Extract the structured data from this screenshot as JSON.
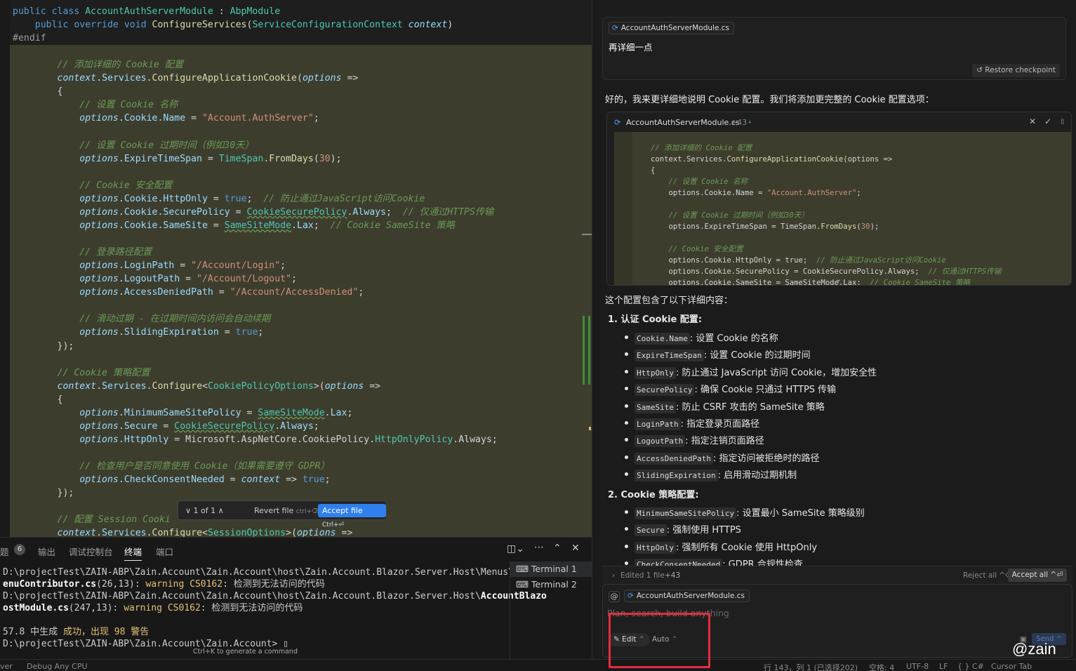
{
  "editor": {
    "lines": [
      [
        [
          "kw",
          "public "
        ],
        [
          "kw",
          "class "
        ],
        [
          "ty",
          "AccountAuthServerModule"
        ],
        [
          "op",
          " : "
        ],
        [
          "ty",
          "AbpModule"
        ]
      ],
      [
        [
          "op",
          "    "
        ],
        [
          "kw",
          "public "
        ],
        [
          "kw",
          "override "
        ],
        [
          "kw",
          "void "
        ],
        [
          "fn",
          "ConfigureServices"
        ],
        [
          "op",
          "("
        ],
        [
          "ty",
          "ServiceConfigurationContext"
        ],
        [
          "op",
          " "
        ],
        [
          "pr it",
          "context"
        ],
        [
          "op",
          ")"
        ]
      ],
      [
        [
          "pp",
          "#endif"
        ]
      ],
      [
        [
          "op",
          ""
        ]
      ],
      [
        [
          "cm",
          "        // 添加详细的 Cookie 配置"
        ]
      ],
      [
        [
          "op",
          "        "
        ],
        [
          "pr it",
          "context"
        ],
        [
          "op",
          "."
        ],
        [
          "pr",
          "Services"
        ],
        [
          "op",
          "."
        ],
        [
          "fn",
          "ConfigureApplicationCookie"
        ],
        [
          "op",
          "("
        ],
        [
          "pr it",
          "options"
        ],
        [
          "op",
          " =>"
        ]
      ],
      [
        [
          "op",
          "        {"
        ]
      ],
      [
        [
          "cm",
          "            // 设置 Cookie 名称"
        ]
      ],
      [
        [
          "op",
          "            "
        ],
        [
          "pr it",
          "options"
        ],
        [
          "op",
          "."
        ],
        [
          "pr",
          "Cookie"
        ],
        [
          "op",
          "."
        ],
        [
          "pr",
          "Name"
        ],
        [
          "op",
          " = "
        ],
        [
          "st",
          "\"Account.AuthServer\""
        ],
        [
          "op",
          ";"
        ]
      ],
      [
        [
          "op",
          ""
        ]
      ],
      [
        [
          "cm",
          "            // 设置 Cookie 过期时间（例如30天）"
        ]
      ],
      [
        [
          "op",
          "            "
        ],
        [
          "pr it",
          "options"
        ],
        [
          "op",
          "."
        ],
        [
          "pr",
          "ExpireTimeSpan"
        ],
        [
          "op",
          " = "
        ],
        [
          "ty",
          "TimeSpan"
        ],
        [
          "op",
          "."
        ],
        [
          "fn",
          "FromDays"
        ],
        [
          "op",
          "("
        ],
        [
          "st",
          "30"
        ],
        [
          "op",
          ");"
        ]
      ],
      [
        [
          "op",
          ""
        ]
      ],
      [
        [
          "cm",
          "            // Cookie 安全配置"
        ]
      ],
      [
        [
          "op",
          "            "
        ],
        [
          "pr it",
          "options"
        ],
        [
          "op",
          "."
        ],
        [
          "pr",
          "Cookie"
        ],
        [
          "op",
          "."
        ],
        [
          "pr",
          "HttpOnly"
        ],
        [
          "op",
          " = "
        ],
        [
          "kw",
          "true"
        ],
        [
          "op",
          ";  "
        ],
        [
          "cm",
          "// 防止通过JavaScript访问Cookie"
        ]
      ],
      [
        [
          "op",
          "            "
        ],
        [
          "pr it",
          "options"
        ],
        [
          "op",
          "."
        ],
        [
          "pr",
          "Cookie"
        ],
        [
          "op",
          "."
        ],
        [
          "pr",
          "SecurePolicy"
        ],
        [
          "op",
          " = "
        ],
        [
          "ty sq",
          "CookieSecurePolicy"
        ],
        [
          "op",
          "."
        ],
        [
          "pr",
          "Always"
        ],
        [
          "op",
          ";  "
        ],
        [
          "cm",
          "// 仅通过HTTPS传输"
        ]
      ],
      [
        [
          "op",
          "            "
        ],
        [
          "pr it",
          "options"
        ],
        [
          "op",
          "."
        ],
        [
          "pr",
          "Cookie"
        ],
        [
          "op",
          "."
        ],
        [
          "pr",
          "SameSite"
        ],
        [
          "op",
          " = "
        ],
        [
          "ty sq",
          "SameSiteMode"
        ],
        [
          "op",
          "."
        ],
        [
          "pr",
          "Lax"
        ],
        [
          "op",
          ";  "
        ],
        [
          "cm",
          "// Cookie SameSite 策略"
        ]
      ],
      [
        [
          "op",
          ""
        ]
      ],
      [
        [
          "cm",
          "            // 登录路径配置"
        ]
      ],
      [
        [
          "op",
          "            "
        ],
        [
          "pr it",
          "options"
        ],
        [
          "op",
          "."
        ],
        [
          "pr",
          "LoginPath"
        ],
        [
          "op",
          " = "
        ],
        [
          "st",
          "\"/Account/Login\""
        ],
        [
          "op",
          ";"
        ]
      ],
      [
        [
          "op",
          "            "
        ],
        [
          "pr it",
          "options"
        ],
        [
          "op",
          "."
        ],
        [
          "pr",
          "LogoutPath"
        ],
        [
          "op",
          " = "
        ],
        [
          "st",
          "\"/Account/Logout\""
        ],
        [
          "op",
          ";"
        ]
      ],
      [
        [
          "op",
          "            "
        ],
        [
          "pr it",
          "options"
        ],
        [
          "op",
          "."
        ],
        [
          "pr",
          "AccessDeniedPath"
        ],
        [
          "op",
          " = "
        ],
        [
          "st",
          "\"/Account/AccessDenied\""
        ],
        [
          "op",
          ";"
        ]
      ],
      [
        [
          "op",
          ""
        ]
      ],
      [
        [
          "cm",
          "            // 滑动过期 - 在过期时间内访问会自动续期"
        ]
      ],
      [
        [
          "op",
          "            "
        ],
        [
          "pr it",
          "options"
        ],
        [
          "op",
          "."
        ],
        [
          "pr",
          "SlidingExpiration"
        ],
        [
          "op",
          " = "
        ],
        [
          "kw",
          "true"
        ],
        [
          "op",
          ";"
        ]
      ],
      [
        [
          "op",
          "        });"
        ]
      ],
      [
        [
          "op",
          ""
        ]
      ],
      [
        [
          "cm",
          "        // Cookie 策略配置"
        ]
      ],
      [
        [
          "op",
          "        "
        ],
        [
          "pr it",
          "context"
        ],
        [
          "op",
          "."
        ],
        [
          "pr",
          "Services"
        ],
        [
          "op",
          "."
        ],
        [
          "fn",
          "Configure"
        ],
        [
          "op",
          "<"
        ],
        [
          "ty",
          "CookiePolicyOptions"
        ],
        [
          "op",
          ">("
        ],
        [
          "pr it",
          "options"
        ],
        [
          "op",
          " =>"
        ]
      ],
      [
        [
          "op",
          "        {"
        ]
      ],
      [
        [
          "op",
          "            "
        ],
        [
          "pr it",
          "options"
        ],
        [
          "op",
          "."
        ],
        [
          "pr",
          "MinimumSameSitePolicy"
        ],
        [
          "op",
          " = "
        ],
        [
          "ty sq",
          "SameSiteMode"
        ],
        [
          "op",
          "."
        ],
        [
          "pr",
          "Lax"
        ],
        [
          "op",
          ";"
        ]
      ],
      [
        [
          "op",
          "            "
        ],
        [
          "pr it",
          "options"
        ],
        [
          "op",
          "."
        ],
        [
          "pr",
          "Secure"
        ],
        [
          "op",
          " = "
        ],
        [
          "ty sq",
          "CookieSecurePolicy"
        ],
        [
          "op",
          "."
        ],
        [
          "pr",
          "Always"
        ],
        [
          "op",
          ";"
        ]
      ],
      [
        [
          "op",
          "            "
        ],
        [
          "pr it",
          "options"
        ],
        [
          "op",
          "."
        ],
        [
          "pr",
          "HttpOnly"
        ],
        [
          "op",
          " = Microsoft.AspNetCore.CookiePolicy."
        ],
        [
          "ty",
          "HttpOnlyPolicy"
        ],
        [
          "op",
          ".Always;"
        ]
      ],
      [
        [
          "op",
          ""
        ]
      ],
      [
        [
          "cm",
          "            // 检查用户是否同意使用 Cookie（如果需要遵守 GDPR）"
        ]
      ],
      [
        [
          "op",
          "            "
        ],
        [
          "pr it",
          "options"
        ],
        [
          "op",
          "."
        ],
        [
          "pr",
          "CheckConsentNeeded"
        ],
        [
          "op",
          " = "
        ],
        [
          "pr it",
          "context"
        ],
        [
          "op",
          " => "
        ],
        [
          "kw",
          "true"
        ],
        [
          "op",
          ";"
        ]
      ],
      [
        [
          "op",
          "        });"
        ]
      ],
      [
        [
          "op",
          ""
        ]
      ],
      [
        [
          "cm",
          "        // 配置 Session Cooki"
        ]
      ],
      [
        [
          "op",
          "        "
        ],
        [
          "pr it",
          "context"
        ],
        [
          "op",
          "."
        ],
        [
          "pr",
          "Services"
        ],
        [
          "op",
          "."
        ],
        [
          "fn",
          "Configure"
        ],
        [
          "op",
          "<"
        ],
        [
          "ty",
          "SessionOptions"
        ],
        [
          "op",
          ">("
        ],
        [
          "pr it",
          "options"
        ],
        [
          "op",
          " =>"
        ]
      ]
    ]
  },
  "diff_toolbar": {
    "pager": "∨ 1 of 1 ∧",
    "revert": "Revert file",
    "revert_shortcut": "ctrl+⌫",
    "accept": "Accept file",
    "accept_shortcut": "Ctrl+⏎"
  },
  "panel": {
    "tabs": [
      "题",
      "6",
      "输出",
      "调试控制台",
      "终端",
      "端口"
    ],
    "terminal_lines": [
      [
        [
          "",
          "D:\\projectTest\\ZAIN-ABP\\Zain.Account\\Zain.Account\\host\\Zain.Account.Blazor.Server.Host\\Menus\\"
        ],
        [
          "b",
          "Accoun"
        ]
      ],
      [
        [
          "b",
          "enuContributor.cs"
        ],
        [
          "",
          "(26,13): "
        ],
        [
          "w",
          "warning CS0162"
        ],
        [
          "",
          ": 检测到无法访问的代码"
        ]
      ],
      [
        [
          "",
          "D:\\projectTest\\ZAIN-ABP\\Zain.Account\\Zain.Account\\host\\Zain.Account.Blazor.Server.Host\\"
        ],
        [
          "b",
          "AccountBlazo"
        ]
      ],
      [
        [
          "b",
          "ostModule.cs"
        ],
        [
          "",
          "(247,13): "
        ],
        [
          "w",
          "warning CS0162"
        ],
        [
          "",
          ": 检测到无法访问的代码"
        ]
      ],
      [
        [
          "",
          ""
        ]
      ],
      [
        [
          "",
          "57.8 中生成 "
        ],
        [
          "ok",
          "成功，出现 98 警告"
        ]
      ],
      [
        [
          "",
          "D:\\projectTest\\ZAIN-ABP\\Zain.Account\\Zain.Account> ▯"
        ]
      ]
    ],
    "terminals": [
      "Terminal 1",
      "Terminal 2"
    ],
    "hint": "Ctrl+K to generate a command"
  },
  "status": {
    "left1": "ver",
    "left2": "Debug Any CPU",
    "position": "行 143，列 1 (已选择202)",
    "spaces": "空格: 4",
    "encoding": "UTF-8",
    "eol": "LF",
    "lang": "{ } C#",
    "tab": "Cursor Tab"
  },
  "chat": {
    "file_chip": "AccountAuthServerModule.cs",
    "user_message": "再详细一点",
    "restore": "Restore checkpoint",
    "intro": "好的，我来更详细地说明 Cookie 配置。我们将添加更完整的 Cookie 配置选项：",
    "code_header": "AccountAuthServerModule.cs",
    "code_added": "+43",
    "snippet": [
      [
        [
          "cm",
          "// 添加详细的 Cookie 配置"
        ]
      ],
      [
        [
          "op",
          "context.Services."
        ],
        [
          "fn",
          "ConfigureApplicationCookie"
        ],
        [
          "op",
          "(options =>"
        ]
      ],
      [
        [
          "op",
          "{"
        ]
      ],
      [
        [
          "cm",
          "    // 设置 Cookie 名称"
        ]
      ],
      [
        [
          "op",
          "    options.Cookie.Name = "
        ],
        [
          "st",
          "\"Account.AuthServer\""
        ],
        [
          "op",
          ";"
        ]
      ],
      [
        [
          "op",
          ""
        ]
      ],
      [
        [
          "cm",
          "    // 设置 Cookie 过期时间（例如30天）"
        ]
      ],
      [
        [
          "op",
          "    options.ExpireTimeSpan = TimeSpan."
        ],
        [
          "fn",
          "FromDays"
        ],
        [
          "op",
          "("
        ],
        [
          "st",
          "30"
        ],
        [
          "op",
          ");"
        ]
      ],
      [
        [
          "op",
          ""
        ]
      ],
      [
        [
          "cm",
          "    // Cookie 安全配置"
        ]
      ],
      [
        [
          "op",
          "    options.Cookie.HttpOnly = true;  "
        ],
        [
          "cm",
          "// 防止通过JavaScript访问Cookie"
        ]
      ],
      [
        [
          "op",
          "    options.Cookie.SecurePolicy = CookieSecurePolicy.Always;  "
        ],
        [
          "cm",
          "// 仅通过HTTPS传输"
        ]
      ],
      [
        [
          "op",
          "    options.Cookie.SameSite = SameSiteMode.Lax;  "
        ],
        [
          "cm",
          "// Cookie SameSite 策略"
        ]
      ]
    ],
    "summary": "这个配置包含了以下详细内容：",
    "section1": "1. 认证 Cookie 配置:",
    "items1": [
      [
        "Cookie.Name",
        ": 设置 Cookie 的名称"
      ],
      [
        "ExpireTimeSpan",
        ": 设置 Cookie 的过期时间"
      ],
      [
        "HttpOnly",
        ": 防止通过 JavaScript 访问 Cookie，增加安全性"
      ],
      [
        "SecurePolicy",
        ": 确保 Cookie 只通过 HTTPS 传输"
      ],
      [
        "SameSite",
        ": 防止 CSRF 攻击的 SameSite 策略"
      ],
      [
        "LoginPath",
        ": 指定登录页面路径"
      ],
      [
        "LogoutPath",
        ": 指定注销页面路径"
      ],
      [
        "AccessDeniedPath",
        ": 指定访问被拒绝时的路径"
      ],
      [
        "SlidingExpiration",
        ": 启用滑动过期机制"
      ]
    ],
    "section2": "2. Cookie 策略配置:",
    "items2": [
      [
        "MinimumSameSitePolicy",
        ": 设置最小 SameSite 策略级别"
      ],
      [
        "Secure",
        ": 强制使用 HTTPS"
      ],
      [
        "HttpOnly",
        ": 强制所有 Cookie 使用 HttpOnly"
      ],
      [
        "CheckConsentNeeded",
        ": GDPR 合规性检查"
      ]
    ],
    "edited": "Edited 1 file",
    "edited_count": "+43",
    "reject_all": "Reject all ^⌫",
    "accept_all": "Accept all ^⏎",
    "input_placeholder": "Plan, search, build anything",
    "mode": "Edit",
    "model": "Auto",
    "send": "Send ^"
  },
  "watermark": "@zain"
}
